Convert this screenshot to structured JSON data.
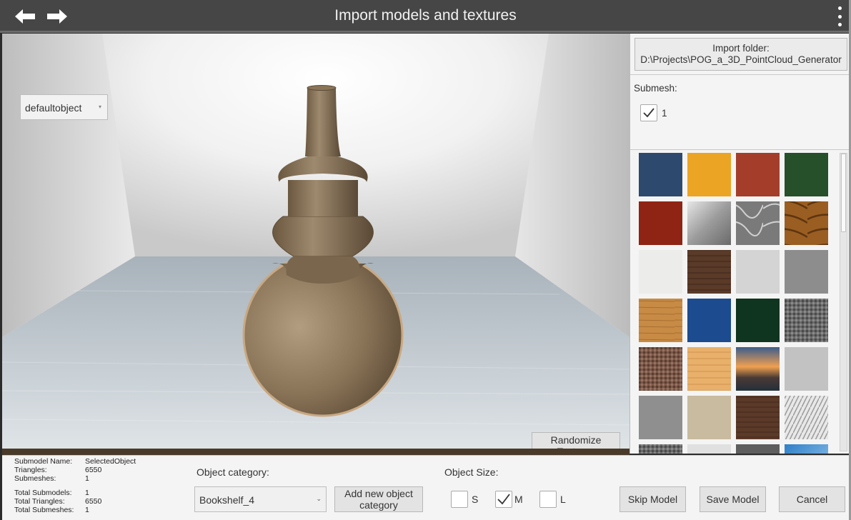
{
  "header": {
    "title": "Import models and textures",
    "back_icon": "arrow-left-icon",
    "forward_icon": "arrow-right-icon",
    "menu_icon": "kebab-menu-icon"
  },
  "viewport": {
    "object_dropdown": {
      "value": "defaultobject"
    },
    "randomize_label": "Randomize\nTextures"
  },
  "right_panel": {
    "import_folder_label": "Import folder:",
    "import_folder_path": "D:\\Projects\\POG_a_3D_PointCloud_Generator",
    "submesh_label": "Submesh:",
    "submeshes": [
      {
        "label": "1",
        "checked": true
      }
    ],
    "textures": [
      "navy-fabric",
      "orange-fabric",
      "red-brick-fabric",
      "green-fabric",
      "red-leather",
      "metal-gradient",
      "gray-marble",
      "brown-wood-swirl",
      "white-plaster",
      "dark-wood",
      "white-marble",
      "gray-metal",
      "light-wood",
      "blue-fabric",
      "dark-green-fabric",
      "gray-weave",
      "brown-weave",
      "pine-wood",
      "mountain-sunset",
      "light-gray-marble",
      "brushed-gray-metal",
      "beige-stone",
      "walnut-wood",
      "white-herringbone",
      "light-weave",
      "white-weave",
      "dark-metal",
      "blue-sky"
    ]
  },
  "bottom_panel": {
    "submodel_name_label": "Submodel Name:",
    "submodel_name_value": "SelectedObject",
    "triangles_label": "Triangles:",
    "triangles_value": "6550",
    "submeshes_label": "Submeshes:",
    "submeshes_value": "1",
    "total_submodels_label": "Total Submodels:",
    "total_submodels_value": "1",
    "total_triangles_label": "Total Triangles:",
    "total_triangles_value": "6550",
    "total_submeshes_label": "Total Submeshes:",
    "total_submeshes_value": "1",
    "object_category_label": "Object category:",
    "object_category_value": "Bookshelf_4",
    "add_category_label": "Add new object\ncategory",
    "object_size_label": "Object Size:",
    "sizes": [
      {
        "label": "S",
        "checked": false
      },
      {
        "label": "M",
        "checked": true
      },
      {
        "label": "L",
        "checked": false
      }
    ],
    "skip_label": "Skip Model",
    "save_label": "Save Model",
    "cancel_label": "Cancel"
  },
  "colors": {
    "topbar": "#464646",
    "vase": "#8a7458",
    "panel": "#f4f4f4"
  }
}
